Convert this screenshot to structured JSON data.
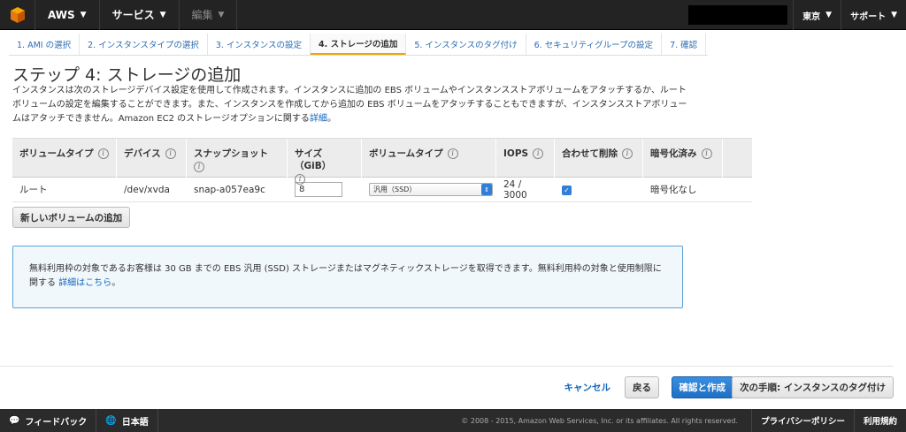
{
  "topnav": {
    "brand": "AWS",
    "services": "サービス",
    "edit": "編集",
    "region": "東京",
    "support": "サポート"
  },
  "wizard": {
    "tabs": [
      {
        "label": "1. AMI の選択"
      },
      {
        "label": "2. インスタンスタイプの選択"
      },
      {
        "label": "3. インスタンスの設定"
      },
      {
        "label": "4. ストレージの追加"
      },
      {
        "label": "5. インスタンスのタグ付け"
      },
      {
        "label": "6. セキュリティグループの設定"
      },
      {
        "label": "7. 確認"
      }
    ],
    "active_index": 3
  },
  "page": {
    "title": "ステップ 4: ストレージの追加",
    "description": "インスタンスは次のストレージデバイス設定を使用して作成されます。インスタンスに追加の EBS ボリュームやインスタンスストアボリュームをアタッチするか、ルートボリュームの設定を編集することができます。また、インスタンスを作成してから追加の EBS ボリュームをアタッチすることもできますが、インスタンスストアボリュームはアタッチできません。Amazon EC2 のストレージオプションに関する",
    "description_link": "詳細",
    "description_end": "。"
  },
  "table": {
    "headers": {
      "volume_type": "ボリュームタイプ",
      "device": "デバイス",
      "snapshot": "スナップショット",
      "size": "サイズ（GiB）",
      "ebs_type": "ボリュームタイプ",
      "iops": "IOPS",
      "delete_on_termination": "合わせて削除",
      "encrypted": "暗号化済み"
    },
    "row": {
      "volume_type": "ルート",
      "device": "/dev/xvda",
      "snapshot": "snap-a057ea9c",
      "size": "8",
      "ebs_type": "汎用（SSD）",
      "iops": "24 / 3000",
      "delete_on_termination": true,
      "encrypted": "暗号化なし"
    }
  },
  "add_volume_button": "新しいボリュームの追加",
  "info_box": {
    "text": "無料利用枠の対象であるお客様は 30 GB までの EBS 汎用 (SSD) ストレージまたはマグネティックストレージを取得できます。無料利用枠の対象と使用制限に関する",
    "link": "詳細はこちら",
    "end": "。"
  },
  "actions": {
    "cancel": "キャンセル",
    "back": "戻る",
    "review_launch": "確認と作成",
    "next": "次の手順: インスタンスのタグ付け"
  },
  "bottombar": {
    "feedback": "フィードバック",
    "language": "日本語",
    "copyright": "© 2008 - 2015, Amazon Web Services, Inc. or its affiliates. All rights reserved.",
    "privacy": "プライバシーポリシー",
    "terms": "利用規約"
  },
  "colors": {
    "accent": "#f0a400",
    "link": "#1166bb",
    "primary_button": "#2f7ed8",
    "topbar": "#232323"
  }
}
